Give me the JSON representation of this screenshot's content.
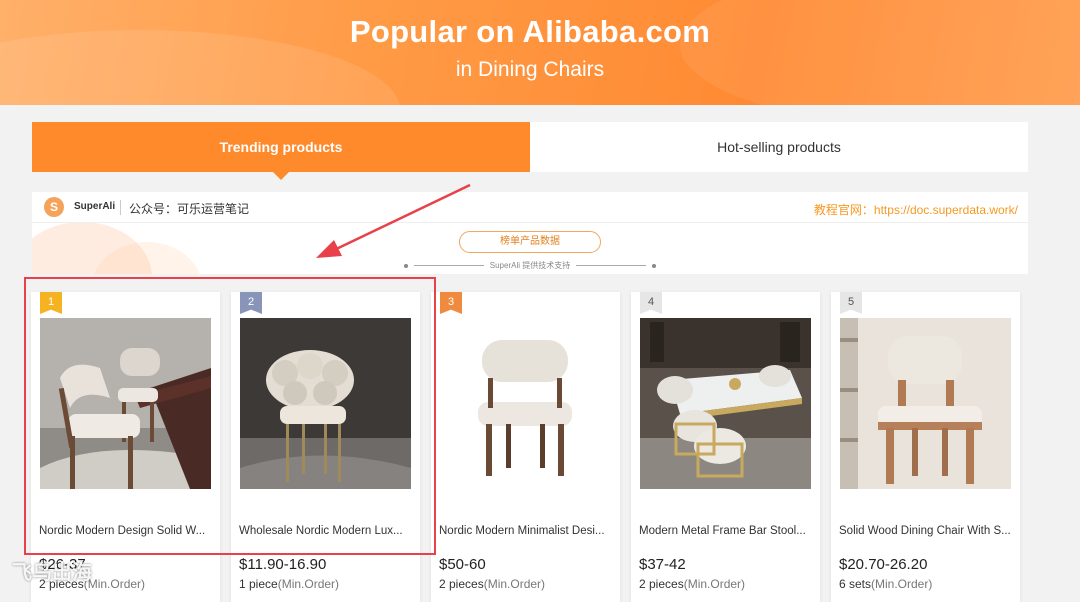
{
  "banner": {
    "title": "Popular on Alibaba.com",
    "subtitle": "in Dining Chairs"
  },
  "tabs": [
    {
      "label": "Trending products",
      "active": true
    },
    {
      "label": "Hot-selling products",
      "active": false
    }
  ],
  "plugin": {
    "logo_letter": "S",
    "brand": "SuperAli",
    "wechat": "公众号：可乐运营笔记",
    "doc_site": "教程官网：https://doc.superdata.work/",
    "data_button": "榜单产品数据",
    "support_text": "SuperAli 提供技术支持"
  },
  "products": [
    {
      "rank": "1",
      "title": "Nordic Modern Design Solid W...",
      "price": "$26-37",
      "moq": "2 pieces",
      "moq_note": "(Min.Order)"
    },
    {
      "rank": "2",
      "title": "Wholesale Nordic Modern Lux...",
      "price": "$11.90-16.90",
      "moq": "1 piece",
      "moq_note": "(Min.Order)"
    },
    {
      "rank": "3",
      "title": "Nordic Modern Minimalist Desi...",
      "price": "$50-60",
      "moq": "2 pieces",
      "moq_note": "(Min.Order)"
    },
    {
      "rank": "4",
      "title": "Modern Metal Frame Bar Stool...",
      "price": "$37-42",
      "moq": "2 pieces",
      "moq_note": "(Min.Order)"
    },
    {
      "rank": "5",
      "title": "Solid Wood Dining Chair With S...",
      "price": "$20.70-26.20",
      "moq": "6 sets",
      "moq_note": "(Min.Order)"
    }
  ],
  "watermark": "飞鸟出海",
  "colors": {
    "accent": "#ff8a2b",
    "highlight_box": "#e8414a",
    "doc_link": "#f59a23"
  }
}
